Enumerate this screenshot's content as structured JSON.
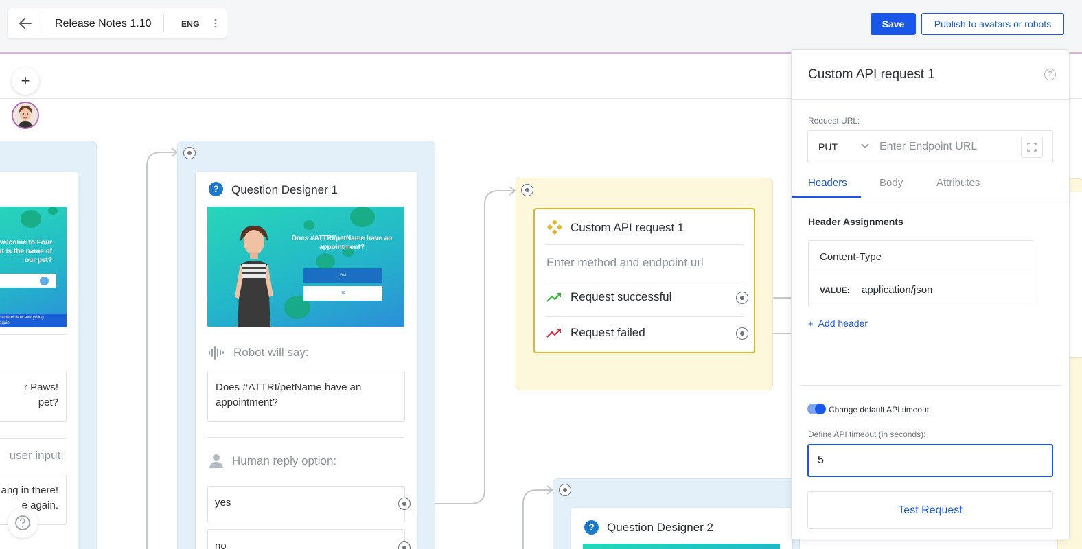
{
  "header": {
    "title": "Release Notes 1.10",
    "language": "ENG",
    "save_label": "Save",
    "publish_label": "Publish to avatars or robots"
  },
  "canvas": {
    "add_label": "+",
    "left_card": {
      "preview_text": "welcome to Four\nat is the name of\nour pet?",
      "preview_footer": "g in there! Now everything\ne again.",
      "robot_text": "r Paws!\npet?",
      "user_input_label": "user input:",
      "reply_text": "ang in there!\ne again."
    },
    "question_designer_1": {
      "title": "Question Designer 1",
      "icon": "question-icon",
      "preview_question": "Does #ATTRI/petName have an appointment?",
      "preview_btn_yes": "yes",
      "preview_btn_no": "no",
      "robot_label": "Robot will say:",
      "robot_text": "Does #ATTRI/petName have an appointment?",
      "human_label": "Human reply option:",
      "options": [
        "yes",
        "no"
      ]
    },
    "api_node": {
      "title": "Custom API request 1",
      "icon": "api-icon",
      "placeholder": "Enter method and endpoint url",
      "success_label": "Request successful",
      "failed_label": "Request failed"
    },
    "question_designer_2": {
      "title": "Question Designer 2",
      "icon": "question-icon"
    }
  },
  "panel": {
    "title": "Custom API request 1",
    "request_url_label": "Request URL:",
    "method": "PUT",
    "url_placeholder": "Enter Endpoint URL",
    "tabs": [
      {
        "label": "Headers",
        "active": true
      },
      {
        "label": "Body",
        "active": false
      },
      {
        "label": "Attributes",
        "active": false
      }
    ],
    "header_assignments_title": "Header Assignments",
    "header": {
      "key": "Content-Type",
      "value_label": "VALUE:",
      "value": "application/json"
    },
    "add_header_label": "Add header",
    "timeout_toggle_label": "Change default API timeout",
    "timeout_toggle_on": true,
    "timeout_label": "Define API timeout (in seconds):",
    "timeout_value": "5",
    "test_button_label": "Test Request"
  },
  "colors": {
    "accent": "#1857e8",
    "lane_blue": "#e3f0fa",
    "lane_yellow": "#fdf7dc",
    "api_border": "#e2b62a",
    "success": "#2eb82e",
    "failure": "#d9273b"
  }
}
